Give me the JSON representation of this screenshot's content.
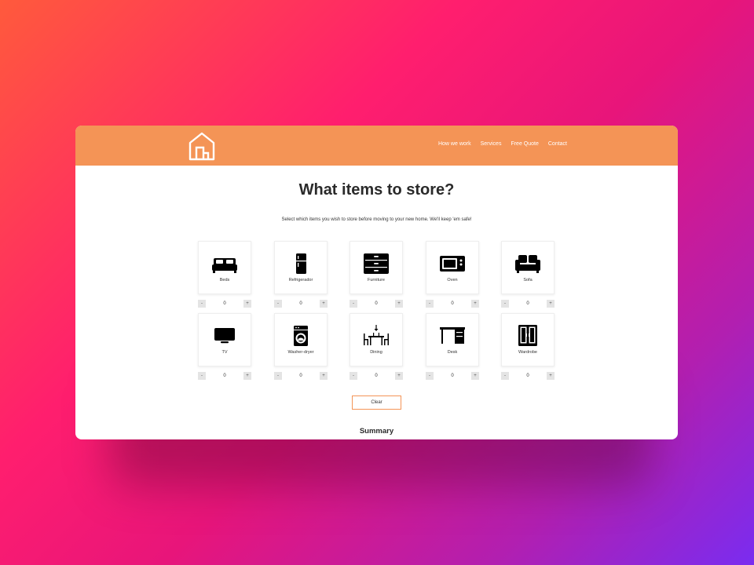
{
  "nav": [
    "How we work",
    "Services",
    "Free Quote",
    "Contact"
  ],
  "heading": "What items to store?",
  "subheading": "Select which items you wish to store before moving to your new home. We'll keep 'em safe!",
  "items": [
    {
      "label": "Beds",
      "icon": "bed-icon",
      "count": "0"
    },
    {
      "label": "Refrigerador",
      "icon": "fridge-icon",
      "count": "0"
    },
    {
      "label": "Furniture",
      "icon": "dresser-icon",
      "count": "0"
    },
    {
      "label": "Oven",
      "icon": "microwave-icon",
      "count": "0"
    },
    {
      "label": "Sofa",
      "icon": "sofa-icon",
      "count": "0"
    },
    {
      "label": "TV",
      "icon": "tv-icon",
      "count": "0"
    },
    {
      "label": "Washer-dryer",
      "icon": "washer-icon",
      "count": "0"
    },
    {
      "label": "Dining",
      "icon": "dining-icon",
      "count": "0"
    },
    {
      "label": "Desk",
      "icon": "desk-icon",
      "count": "0"
    },
    {
      "label": "Wardrobe",
      "icon": "wardrobe-icon",
      "count": "0"
    }
  ],
  "stepper": {
    "minus": "-",
    "plus": "+"
  },
  "clear_label": "Clear",
  "summary_title": "Summary",
  "colors": {
    "accent": "#f49456"
  }
}
